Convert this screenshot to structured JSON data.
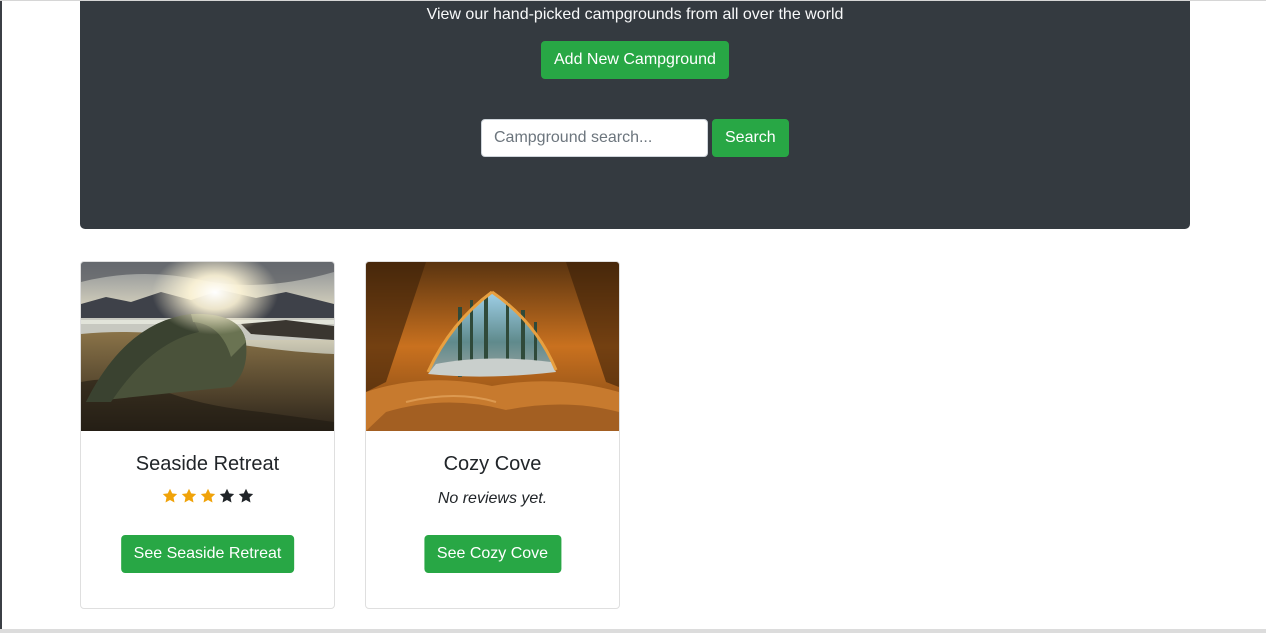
{
  "header": {
    "lead": "View our hand-picked campgrounds from all over the world",
    "add_button": "Add New Campground",
    "search_placeholder": "Campground search...",
    "search_button": "Search"
  },
  "colors": {
    "jumbotron_bg": "#343a40",
    "success_green": "#28a745",
    "star_filled": "#f0a30a",
    "star_empty": "#212529"
  },
  "campgrounds": [
    {
      "title": "Seaside Retreat",
      "image_icon": "tent-seaside-photo",
      "rating": 3,
      "rating_max": 5,
      "button": "See Seaside Retreat"
    },
    {
      "title": "Cozy Cove",
      "image_icon": "tent-forest-photo",
      "reviews_text": "No reviews yet.",
      "button": "See Cozy Cove"
    }
  ]
}
